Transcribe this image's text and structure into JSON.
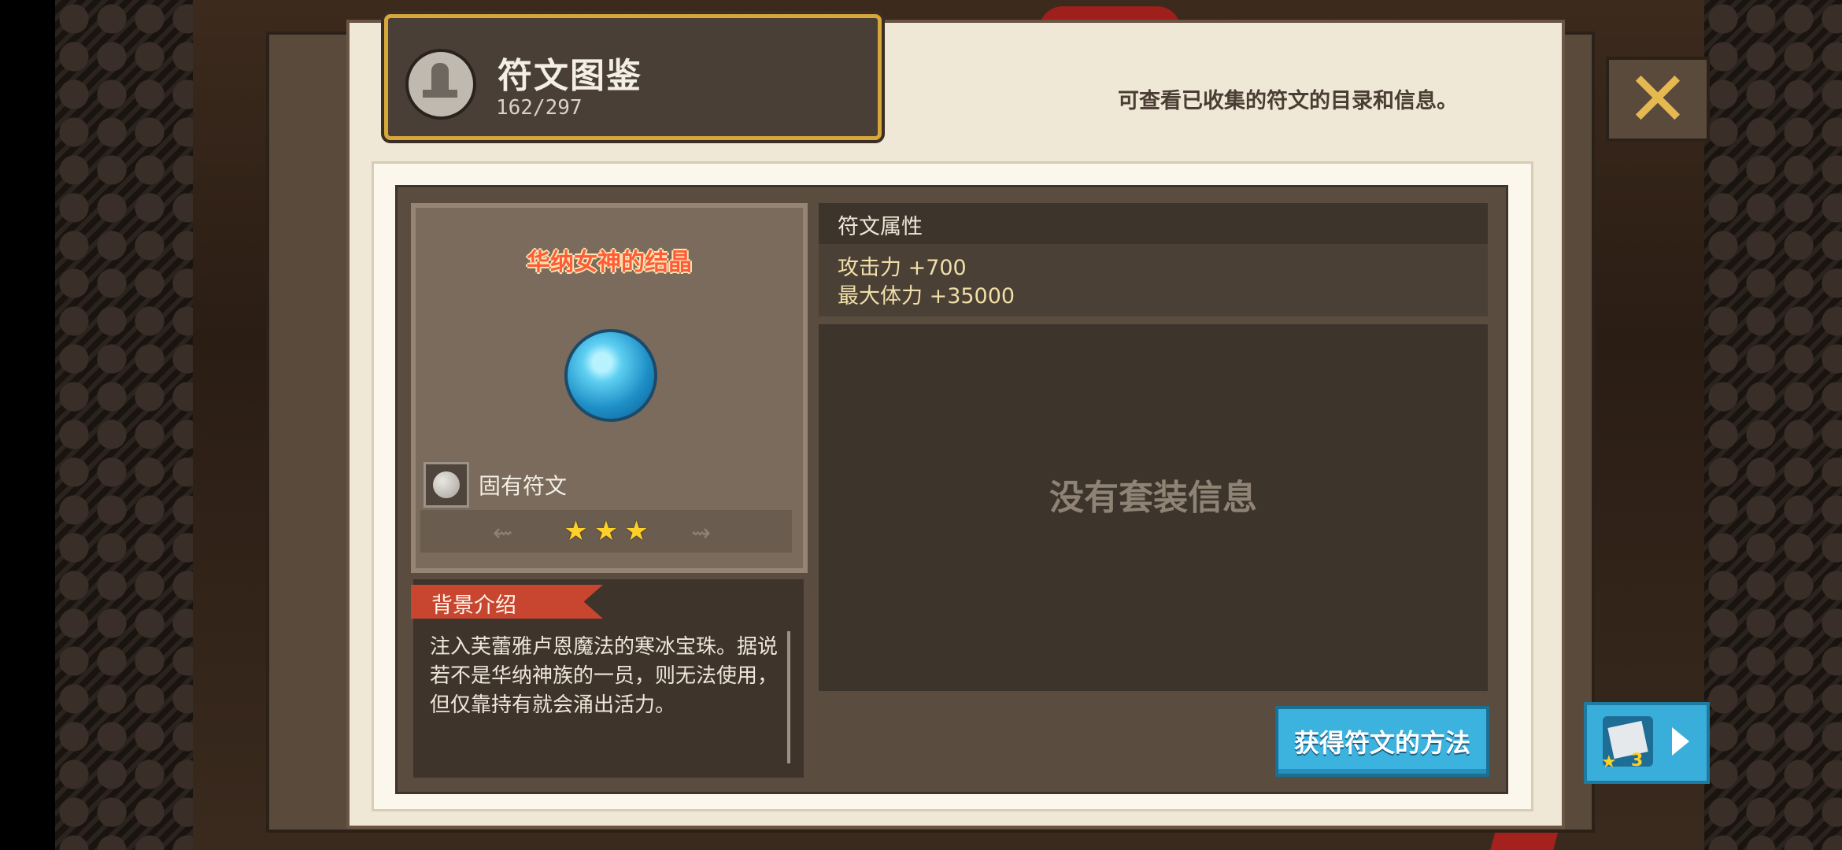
{
  "header": {
    "title": "符文图鉴",
    "count": "162/297",
    "subtitle": "可查看已收集的符文的目录和信息。"
  },
  "close_icon": "close-icon",
  "rune": {
    "name": "华纳女神的结晶",
    "gem_icon": "ice-orb-icon",
    "type_icon": "stone-icon",
    "type_label": "固有符文",
    "stars": 3,
    "max_stars": 3
  },
  "story": {
    "tag": "背景介绍",
    "text": "注入芙蕾雅卢恩魔法的寒冰宝珠。据说若不是华纳神族的一员，则无法使用，但仅靠持有就会涌出活力。"
  },
  "attributes": {
    "header": "符文属性",
    "lines": [
      "攻击力 +700",
      "最大体力 +35000"
    ]
  },
  "set_info": {
    "empty_text": "没有套装信息"
  },
  "buttons": {
    "how_to_get": "获得符文的方法",
    "side_badge": "3"
  },
  "colors": {
    "accent_gold": "#d8a73a",
    "name_red": "#ff5b3b",
    "button_blue": "#3bb3de",
    "star_yellow": "#ffd028"
  }
}
